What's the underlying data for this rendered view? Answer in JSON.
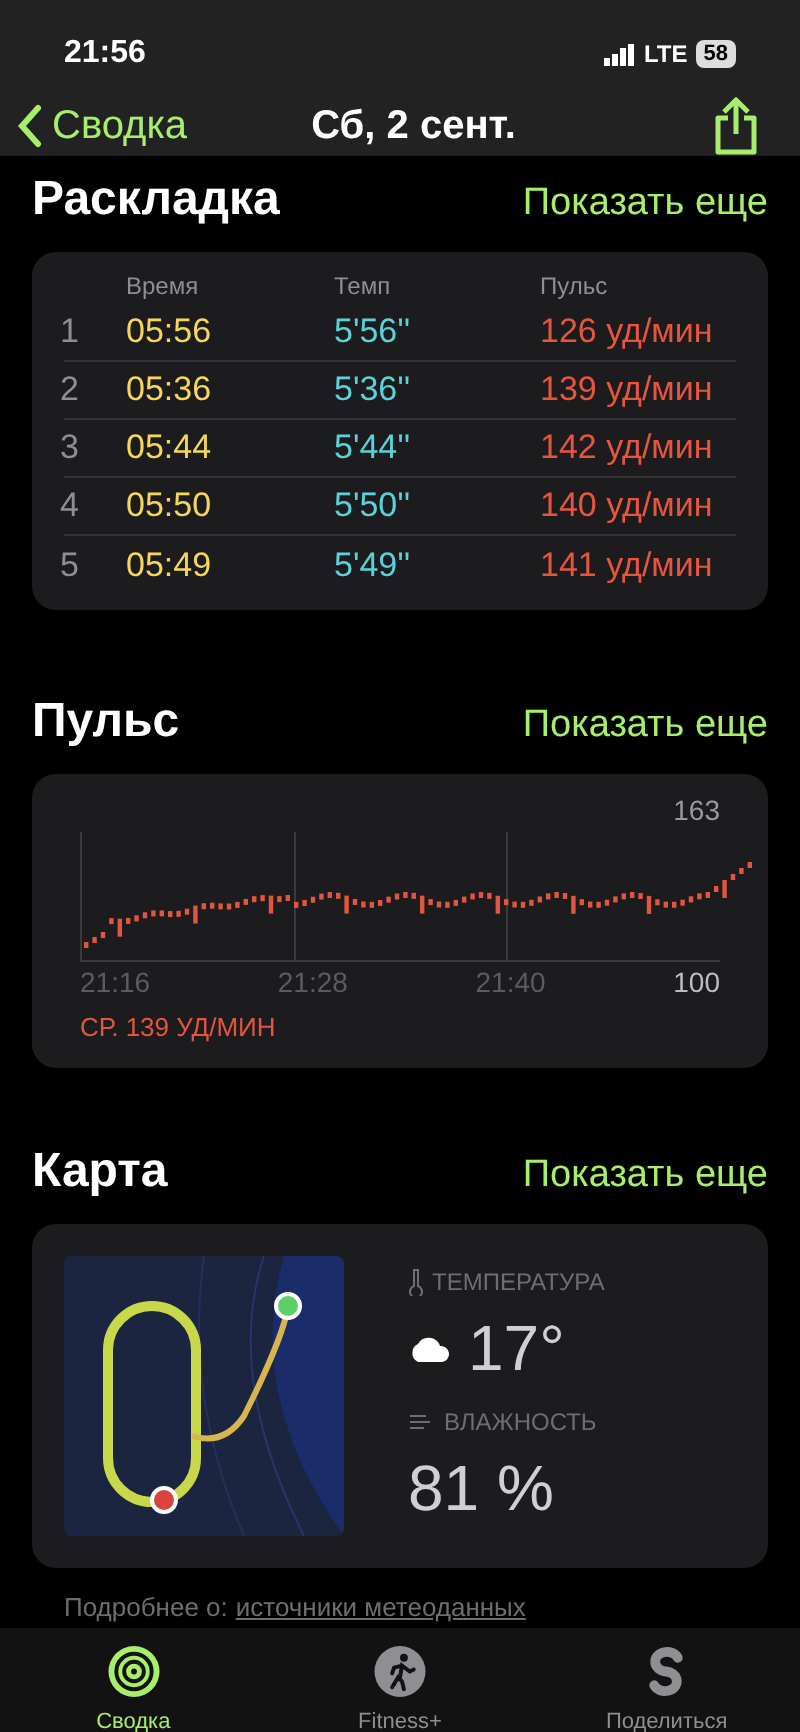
{
  "status_bar": {
    "time": "21:56",
    "network": "LTE",
    "battery": "58"
  },
  "nav": {
    "back": "Сводка",
    "title": "Сб, 2 сент."
  },
  "splits": {
    "title": "Раскладка",
    "more": "Показать еще",
    "columns": [
      "Время",
      "Темп",
      "Пульс"
    ],
    "rows": [
      {
        "index": "1",
        "time": "05:56",
        "pace": "5'56''",
        "hr": "126 уд/мин"
      },
      {
        "index": "2",
        "time": "05:36",
        "pace": "5'36''",
        "hr": "139 уд/мин"
      },
      {
        "index": "3",
        "time": "05:44",
        "pace": "5'44''",
        "hr": "142 уд/мин"
      },
      {
        "index": "4",
        "time": "05:50",
        "pace": "5'50''",
        "hr": "140 уд/мин"
      },
      {
        "index": "5",
        "time": "05:49",
        "pace": "5'49''",
        "hr": "141 уд/мин"
      }
    ]
  },
  "heart": {
    "title": "Пульс",
    "more": "Показать еще",
    "max": "163",
    "min": "100",
    "times": [
      "21:16",
      "21:28",
      "21:40"
    ],
    "average": "СР. 139 УД/МИН"
  },
  "map": {
    "title": "Карта",
    "more": "Показать еще",
    "temperature_label": "ТЕМПЕРАТУРА",
    "temperature": "17°",
    "humidity_label": "ВЛАЖНОСТЬ",
    "humidity": "81 %",
    "note": "Подробнее о:",
    "link": "источники метеоданных"
  },
  "tabs": [
    {
      "label": "Сводка",
      "selected": true
    },
    {
      "label": "Fitness+",
      "selected": false
    },
    {
      "label": "Поделиться",
      "selected": false
    }
  ]
}
